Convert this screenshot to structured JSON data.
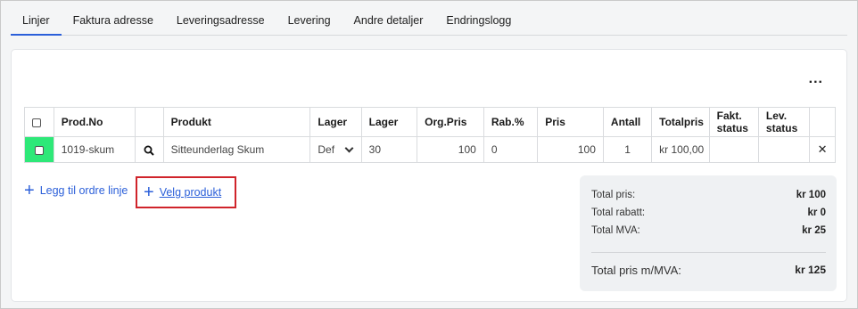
{
  "tabs": [
    {
      "label": "Linjer"
    },
    {
      "label": "Faktura adresse"
    },
    {
      "label": "Leveringsadresse"
    },
    {
      "label": "Levering"
    },
    {
      "label": "Andre detaljer"
    },
    {
      "label": "Endringslogg"
    }
  ],
  "more_label": "...",
  "table": {
    "headers": {
      "prodno": "Prod.No",
      "produkt": "Produkt",
      "lager1": "Lager",
      "lager2": "Lager",
      "orgpris": "Org.Pris",
      "rabatt": "Rab.%",
      "pris": "Pris",
      "antall": "Antall",
      "totalpris": "Totalpris",
      "fakt_status": "Fakt. status",
      "lev_status": "Lev. status"
    },
    "rows": [
      {
        "prodno": "1019-skum",
        "produkt": "Sitteunderlag Skum",
        "lager_select": "Def",
        "lager_qty": "30",
        "orgpris": "100",
        "rabatt": "0",
        "pris": "100",
        "antall": "1",
        "totalpris": "kr 100,00",
        "fakt_status": "",
        "lev_status": "",
        "remove": "✕"
      }
    ]
  },
  "actions": {
    "add_line": "Legg til ordre linje",
    "pick_product": "Velg produkt",
    "plus": "+"
  },
  "summary": {
    "total_pris_label": "Total pris:",
    "total_pris_value": "kr 100",
    "total_rabatt_label": "Total rabatt:",
    "total_rabatt_value": "kr 0",
    "total_mva_label": "Total MVA:",
    "total_mva_value": "kr 25",
    "total_mmva_label": "Total pris m/MVA:",
    "total_mmva_value": "kr 125"
  },
  "colors": {
    "accent": "#2b5fd9",
    "highlight_border": "#d0242b",
    "selected_row": "#2ee878"
  }
}
